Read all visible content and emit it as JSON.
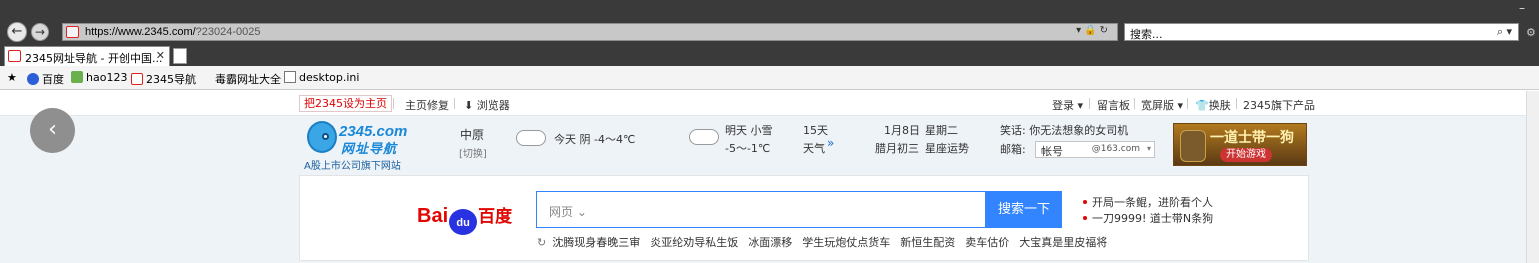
{
  "browser": {
    "url_host": "https://www.2345.com/",
    "url_rest": "?23024-0025",
    "search_placeholder": "搜索...",
    "tab_title": "2345网址导航 - 开创中国...",
    "tab_close": "✕",
    "minimize": "–",
    "favorites": [
      {
        "label": "百度",
        "icon": "paw-icon"
      },
      {
        "label": "hao123",
        "icon": "hao-icon"
      },
      {
        "label": "2345导航",
        "icon": "site-icon"
      },
      {
        "label": "毒霸网址大全",
        "icon": ""
      },
      {
        "label": "desktop.ini",
        "icon": "file-icon"
      }
    ]
  },
  "page": {
    "topbar": {
      "set_home": "把2345设为主页",
      "links_left": [
        "主页修复",
        "浏览器"
      ],
      "links_right": [
        "登录",
        "留言板",
        "宽屏版",
        "换肤",
        "2345旗下产品"
      ]
    },
    "logo": {
      "brand": "2345.com",
      "name": "网址导航",
      "subtitle": "A股上市公司旗下网站"
    },
    "weather": {
      "city": "中原",
      "switch": "[切换]",
      "today": "今天  阴  -4～4℃",
      "tomorrow_label": "明天  小雪",
      "tomorrow_temp": "-5～-1℃",
      "fifteen_days": "15天",
      "forecast": "天气"
    },
    "date": {
      "solar": "1月8日",
      "weekday": "星期二",
      "lunar": "腊月初三",
      "fortune": "星座运势"
    },
    "joke": "笑话: 你无法想象的女司机",
    "mail": {
      "label": "邮箱:",
      "user": "帐号",
      "domain": "@163.com"
    },
    "ad": {
      "title": "一道士带一狗",
      "button": "开始游戏"
    },
    "search": {
      "brand_left": "Bai",
      "brand_paw": "du",
      "brand_right": "百度",
      "scope": "网页",
      "button": "搜索一下",
      "hot": [
        "开局一条鲲，进阶看个人",
        "一刀9999! 道士带N条狗"
      ],
      "tags": [
        "沈腾现身春晚三审",
        "炎亚纶劝导私生饭",
        "冰面漂移",
        "学生玩炮仗点货车",
        "新恒生配资",
        "卖车估价",
        "大宝真是里皮福将"
      ]
    }
  }
}
